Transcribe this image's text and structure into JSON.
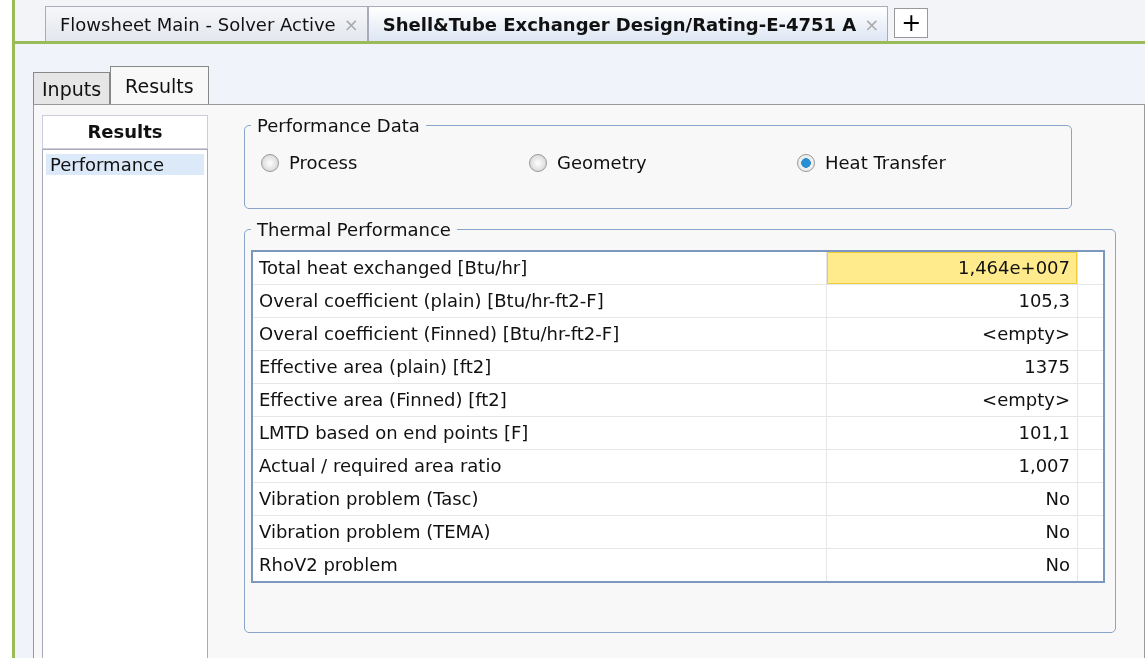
{
  "document_tabs": [
    {
      "label": "Flowsheet Main - Solver Active",
      "close": "×",
      "selected": false
    },
    {
      "label": "Shell&Tube Exchanger Design/Rating-E-4751 A",
      "close": "×",
      "selected": true
    }
  ],
  "new_tab_button": "+",
  "inner_tabs": [
    {
      "label": "Inputs",
      "selected": false
    },
    {
      "label": "Results",
      "selected": true
    }
  ],
  "sidebar": {
    "title": "Results",
    "items": [
      {
        "label": "Performance",
        "selected": true
      }
    ]
  },
  "performance_data": {
    "title": "Performance Data",
    "options": [
      {
        "label": "Process",
        "selected": false
      },
      {
        "label": "Geometry",
        "selected": false
      },
      {
        "label": "Heat Transfer",
        "selected": true
      }
    ]
  },
  "thermal_performance": {
    "title": "Thermal Performance",
    "rows": [
      {
        "label": "Total heat exchanged [Btu/hr]",
        "value": "1,464e+007",
        "selected": true
      },
      {
        "label": "Overal coefficient (plain) [Btu/hr-ft2-F]",
        "value": "105,3",
        "selected": false
      },
      {
        "label": "Overal coefficient (Finned) [Btu/hr-ft2-F]",
        "value": "<empty>",
        "selected": false
      },
      {
        "label": "Effective area (plain) [ft2]",
        "value": "1375",
        "selected": false
      },
      {
        "label": "Effective area (Finned) [ft2]",
        "value": "<empty>",
        "selected": false
      },
      {
        "label": "LMTD based on end points [F]",
        "value": "101,1",
        "selected": false
      },
      {
        "label": "Actual / required area ratio",
        "value": "1,007",
        "selected": false
      },
      {
        "label": "Vibration problem (Tasc)",
        "value": "No",
        "selected": false
      },
      {
        "label": "Vibration problem (TEMA)",
        "value": "No",
        "selected": false
      },
      {
        "label": "RhoV2 problem",
        "value": "No",
        "selected": false
      }
    ]
  }
}
